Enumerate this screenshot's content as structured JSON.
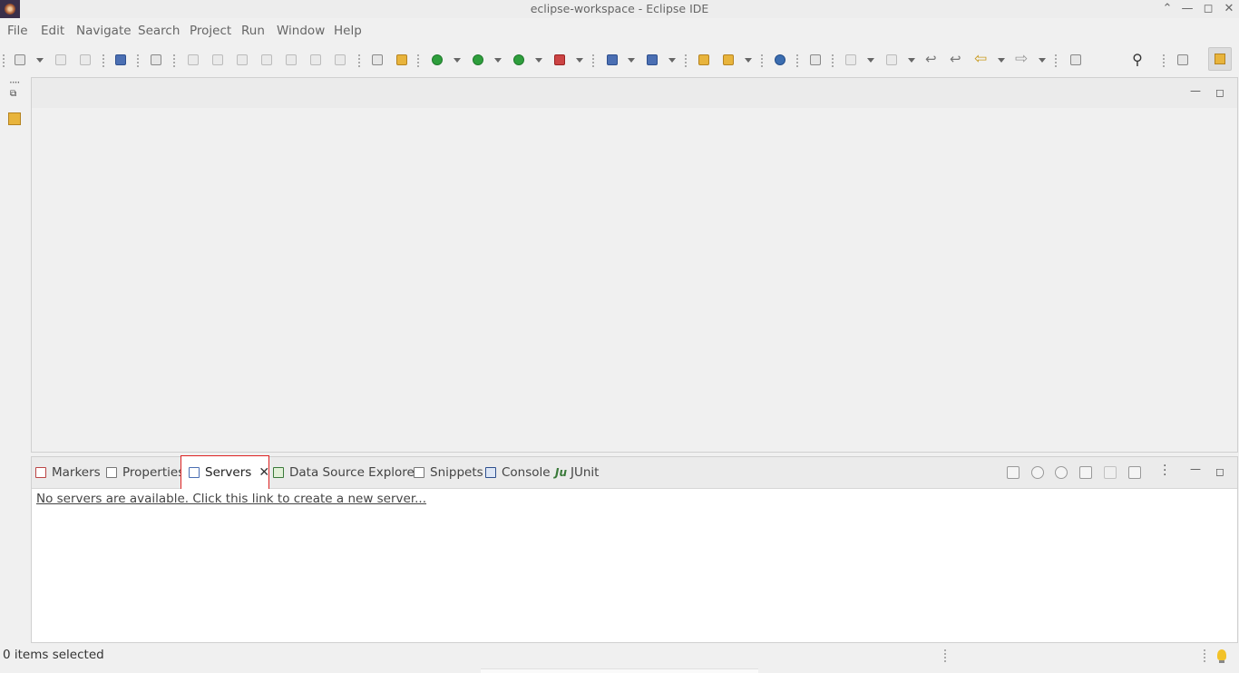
{
  "window": {
    "title": "eclipse-workspace - Eclipse IDE",
    "controls": [
      "chevron-up-icon",
      "minimize-icon",
      "maximize-icon",
      "close-icon"
    ]
  },
  "menu": [
    "File",
    "Edit",
    "Navigate",
    "Search",
    "Project",
    "Run",
    "Window",
    "Help"
  ],
  "bottom_panel": {
    "tabs": [
      {
        "label": "Markers",
        "icon": "markers-icon"
      },
      {
        "label": "Properties",
        "icon": "properties-icon"
      },
      {
        "label": "Servers",
        "icon": "servers-icon",
        "active": true
      },
      {
        "label": "Data Source Explorer",
        "icon": "data-source-icon"
      },
      {
        "label": "Snippets",
        "icon": "snippets-icon"
      },
      {
        "label": "Console",
        "icon": "console-icon"
      },
      {
        "label": "JUnit",
        "icon": "junit-icon"
      }
    ],
    "content_link": "No servers are available. Click this link to create a new server..."
  },
  "status": {
    "text": "0 items selected"
  },
  "colors": {
    "active_tab_border": "#dd2222",
    "background": "#f0f0f0"
  }
}
